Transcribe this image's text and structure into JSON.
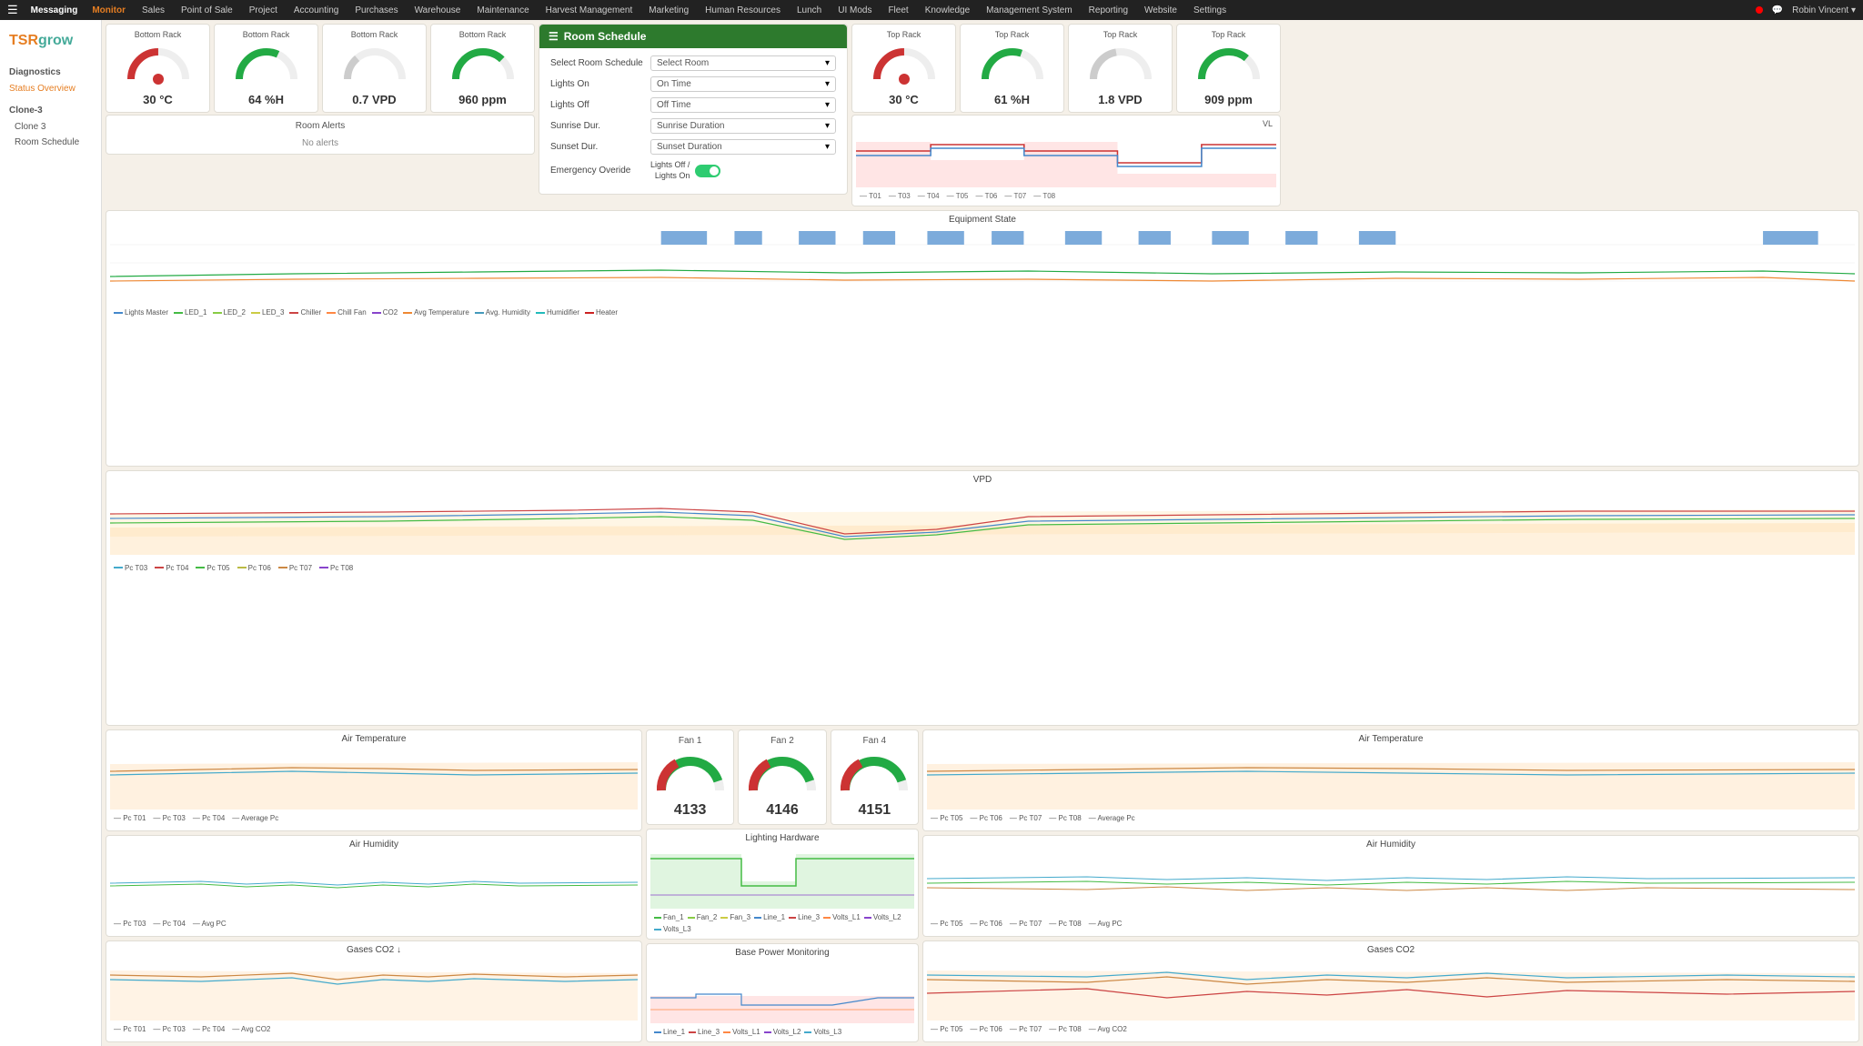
{
  "nav": {
    "hamburger": "☰",
    "items": [
      "Messaging",
      "Monitor",
      "Sales",
      "Point of Sale",
      "Project",
      "Accounting",
      "Purchases",
      "Warehouse",
      "Maintenance",
      "Harvest Management",
      "Marketing",
      "Human Resources",
      "Lunch",
      "UI Mods",
      "Fleet",
      "Knowledge",
      "Management System",
      "Reporting",
      "Website",
      "Settings"
    ],
    "active": "Monitor",
    "user": "Robin Vincent ▾"
  },
  "sidebar": {
    "logo_orange": "TSR",
    "logo_green": "grow",
    "sections": [
      {
        "label": "Diagnostics",
        "items": [
          {
            "label": "Status Overview",
            "active": true
          }
        ]
      },
      {
        "label": "Clone-3",
        "items": [
          {
            "label": "Clone 3"
          },
          {
            "label": "Room Schedule",
            "active": false
          }
        ]
      }
    ]
  },
  "bottom_rack_gauges": [
    {
      "title": "Bottom Rack",
      "value": "30 °C",
      "type": "temp",
      "percent": 0.5
    },
    {
      "title": "Bottom Rack",
      "value": "64 %H",
      "type": "humidity",
      "percent": 0.64
    },
    {
      "title": "Bottom Rack",
      "value": "0.7 VPD",
      "type": "vpd",
      "percent": 0.28
    },
    {
      "title": "Bottom Rack",
      "value": "960 ppm",
      "type": "co2",
      "percent": 0.75
    }
  ],
  "top_rack_gauges": [
    {
      "title": "Top Rack",
      "value": "30 °C",
      "type": "temp",
      "percent": 0.5
    },
    {
      "title": "Top Rack",
      "value": "61 %H",
      "type": "humidity",
      "percent": 0.61
    },
    {
      "title": "Top Rack",
      "value": "1.8 VPD",
      "type": "vpd",
      "percent": 0.55
    },
    {
      "title": "Top Rack",
      "value": "909 ppm",
      "type": "co2",
      "percent": 0.72
    }
  ],
  "room_schedule": {
    "title": "Room Schedule",
    "icon": "☰",
    "fields": [
      {
        "label": "Select Room Schedule",
        "value": "Select Room",
        "type": "select"
      },
      {
        "label": "Lights On",
        "value": "On Time",
        "type": "select"
      },
      {
        "label": "Lights Off",
        "value": "Off Time",
        "type": "select"
      },
      {
        "label": "Sunrise Dur.",
        "value": "Sunrise Duration",
        "type": "select"
      },
      {
        "label": "Sunset Dur.",
        "value": "Sunset Duration",
        "type": "select"
      },
      {
        "label": "Emergency Overide",
        "value": "Lights Off / Lights On",
        "type": "toggle"
      }
    ]
  },
  "alerts": {
    "title": "Room Alerts",
    "message": "No alerts"
  },
  "charts": {
    "equipment_state": {
      "title": "Equipment State",
      "legend": [
        "Lights Master",
        "LED_1",
        "LED_2",
        "LED_3",
        "Chiller",
        "Chill Fan",
        "CO2",
        "Avg Temperature",
        "Avg. Humidity",
        "Humidifier",
        "Heater"
      ],
      "colors": [
        "#4488cc",
        "#44bb44",
        "#88cc44",
        "#cccc44",
        "#cc4444",
        "#ff8844",
        "#8844cc",
        "#ee8833",
        "#4499bb",
        "#22bbbb",
        "#cc2222"
      ]
    },
    "vpd": {
      "title": "VPD",
      "legend": [
        "Pc T03",
        "Pc T04",
        "Pc T05",
        "Pc T06",
        "Pc T07",
        "Pc T08"
      ],
      "colors": [
        "#44aacc",
        "#cc4444",
        "#44bb44",
        "#bbbb44",
        "#cc8844",
        "#8844cc"
      ]
    },
    "air_temp_left": {
      "title": "Air Temperature",
      "legend": [
        "Pc T01",
        "Pc T03",
        "Pc T04",
        "Average Pc"
      ],
      "colors": [
        "#cc8844",
        "#44aacc",
        "#44bb44",
        "#cc4444"
      ]
    },
    "air_humidity_left": {
      "title": "Air Humidity",
      "legend": [
        "Pc T03",
        "Pc T04",
        "Avg PC"
      ],
      "colors": [
        "#44aacc",
        "#44bb44",
        "#cc4444"
      ]
    },
    "gases_co2_left": {
      "title": "Gases CO2 ↓",
      "legend": [
        "Pc T01",
        "Pc T03",
        "Pc T04",
        "Avg CO2"
      ],
      "colors": [
        "#cc8844",
        "#44aacc",
        "#44bb44",
        "#cc4444"
      ]
    },
    "lighting_hardware": {
      "title": "Lighting Hardware",
      "legend": [
        "Fan_1",
        "Fan_2",
        "Fan_3",
        "Line_1",
        "Line_3",
        "Volts_L1",
        "Volts_L2",
        "Volts_L3"
      ],
      "colors": [
        "#44bb44",
        "#88cc44",
        "#cccc44",
        "#4488cc",
        "#cc4444",
        "#ff8844",
        "#8844cc",
        "#44aacc"
      ]
    },
    "base_power": {
      "title": "Base Power Monitoring",
      "legend": [
        "Line_1",
        "Line_3",
        "Volts_L1",
        "Volts_L2",
        "Volts_L3"
      ],
      "colors": [
        "#4488cc",
        "#cc4444",
        "#ff8844",
        "#8844cc",
        "#44aacc"
      ]
    },
    "air_temp_right": {
      "title": "Air Temperature",
      "legend": [
        "Pc T05",
        "Pc T06",
        "Pc T07",
        "Pc T08",
        "Average Pc"
      ],
      "colors": [
        "#cc8844",
        "#44aacc",
        "#44bb44",
        "#cc4444",
        "#8844cc"
      ]
    },
    "air_humidity_right": {
      "title": "Air Humidity",
      "legend": [
        "Pc T05",
        "Pc T06",
        "Pc T07",
        "Pc T08",
        "Avg PC"
      ],
      "colors": [
        "#44aacc",
        "#44bb44",
        "#cc4444",
        "#ff8844",
        "#8844cc"
      ]
    },
    "gases_co2_right": {
      "title": "Gases CO2",
      "legend": [
        "Pc T05",
        "Pc T06",
        "Pc T07",
        "Pc T08",
        "Avg CO2"
      ],
      "colors": [
        "#44aacc",
        "#44bb44",
        "#cc4444",
        "#ff8844",
        "#8844cc"
      ]
    }
  },
  "fans": [
    {
      "title": "Fan 1",
      "value": "4133"
    },
    {
      "title": "Fan 2",
      "value": "4146"
    },
    {
      "title": "Fan 4",
      "value": "4151"
    }
  ],
  "vl": {
    "title": "VL"
  }
}
